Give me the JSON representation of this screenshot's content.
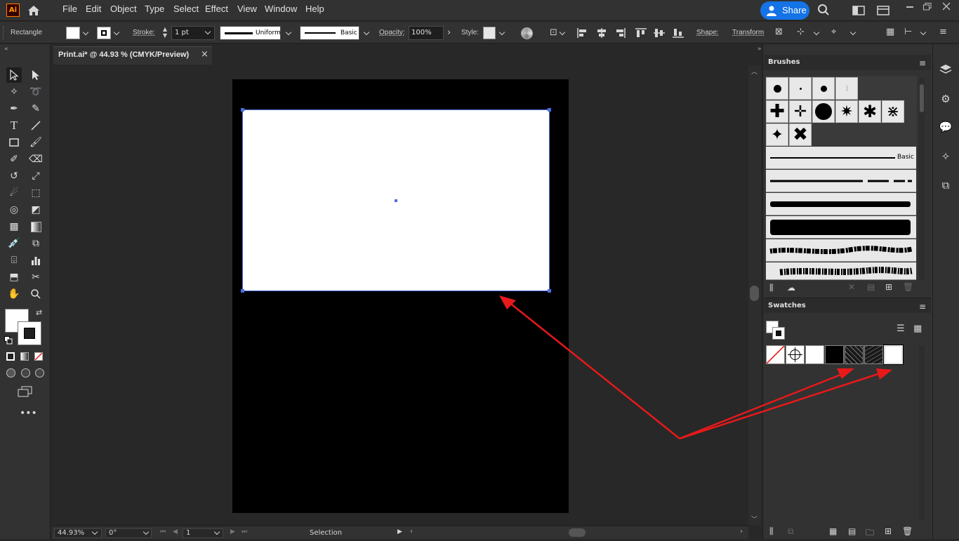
{
  "app": {
    "logo": "Ai"
  },
  "menu": [
    "File",
    "Edit",
    "Object",
    "Type",
    "Select",
    "Effect",
    "View",
    "Window",
    "Help"
  ],
  "share_label": "Share",
  "control": {
    "object_type": "Rectangle",
    "stroke_label": "Stroke:",
    "stroke_weight": "1 pt",
    "profile": "Uniform",
    "brush": "Basic",
    "opacity_label": "Opacity:",
    "opacity": "100%",
    "style_label": "Style:",
    "shape_label": "Shape:",
    "transform_label": "Transform"
  },
  "document": {
    "tab_title": "Print.ai* @ 44.93 % (CMYK/Preview)",
    "close": "×"
  },
  "status": {
    "zoom": "44.93%",
    "rotation": "0°",
    "artboard": "1",
    "tool": "Selection"
  },
  "brushes_panel": {
    "title": "Brushes",
    "basic_label": "Basic"
  },
  "swatches_panel": {
    "title": "Swatches"
  },
  "colors": {
    "accent": "#1473e6",
    "selection": "#4b6fe0",
    "annotation_arrow": "#e8191a"
  }
}
